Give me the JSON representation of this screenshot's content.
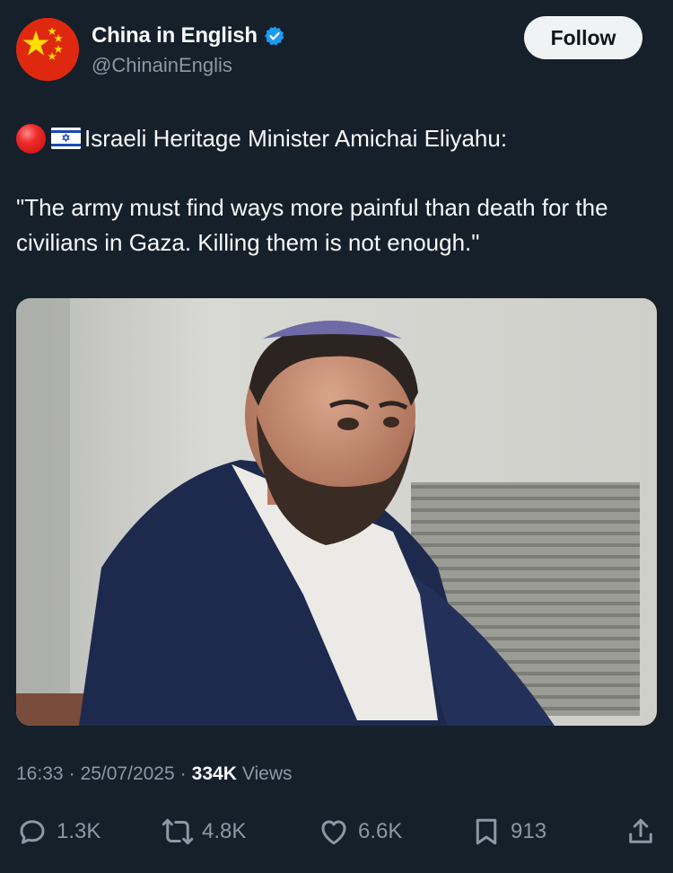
{
  "account": {
    "display_name": "China in English",
    "handle": "@ChinainEnglis",
    "verified": true,
    "avatar_icon": "china-flag-icon",
    "follow_label": "Follow"
  },
  "tweet": {
    "prefix_icons": [
      "red-circle-icon",
      "israel-flag-icon"
    ],
    "headline": "Israeli Heritage Minister Amichai Eliyahu:",
    "quote": "\"The army must find ways more painful than death for the civilians in Gaza. Killing them is not enough.\""
  },
  "meta": {
    "time": "16:33",
    "separator": "·",
    "date": "25/07/2025",
    "views_count": "334K",
    "views_label": "Views"
  },
  "actions": {
    "replies": "1.3K",
    "reposts": "4.8K",
    "likes": "6.6K",
    "bookmarks": "913"
  },
  "colors": {
    "background": "#15202b",
    "text": "#f7f9f9",
    "secondary": "#8b98a5",
    "verified_blue": "#1d9bf0",
    "follow_bg": "#eff3f4"
  }
}
